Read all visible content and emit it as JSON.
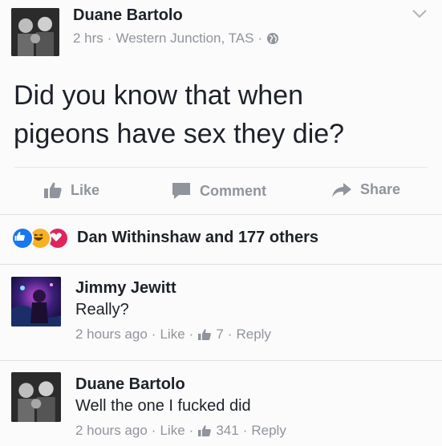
{
  "post": {
    "author": "Duane Bartolo",
    "time": "2 hrs",
    "location": "Western Junction, TAS",
    "dot": "·",
    "text_line1": "Did you know that when",
    "text_line2": "pigeons have sex they die?"
  },
  "actions": {
    "like_label": "Like",
    "comment_label": "Comment",
    "share_label": "Share"
  },
  "reactions": {
    "summary": "Dan Withinshaw and 177 others",
    "colors": {
      "like": "#1877f2",
      "haha": "#f7b125",
      "love": "#e0245e"
    }
  },
  "comments": [
    {
      "author": "Jimmy Jewitt",
      "text": "Really?",
      "time": "2 hours ago",
      "like_label": "Like",
      "like_count": "7",
      "reply_label": "Reply"
    },
    {
      "author": "Duane Bartolo",
      "text": "Well the one I fucked did",
      "time": "2 hours ago",
      "like_label": "Like",
      "like_count": "341",
      "reply_label": "Reply"
    }
  ],
  "icons": {
    "post_avatar": "profile-photo",
    "chevron": "chevron-down-icon",
    "globe": "globe-icon",
    "like": "thumbs-up-icon",
    "comment": "speech-bubble-icon",
    "share": "share-arrow-icon"
  },
  "colors": {
    "text": "#1d2129",
    "muted": "#90949c",
    "divider": "#dddfe2"
  }
}
